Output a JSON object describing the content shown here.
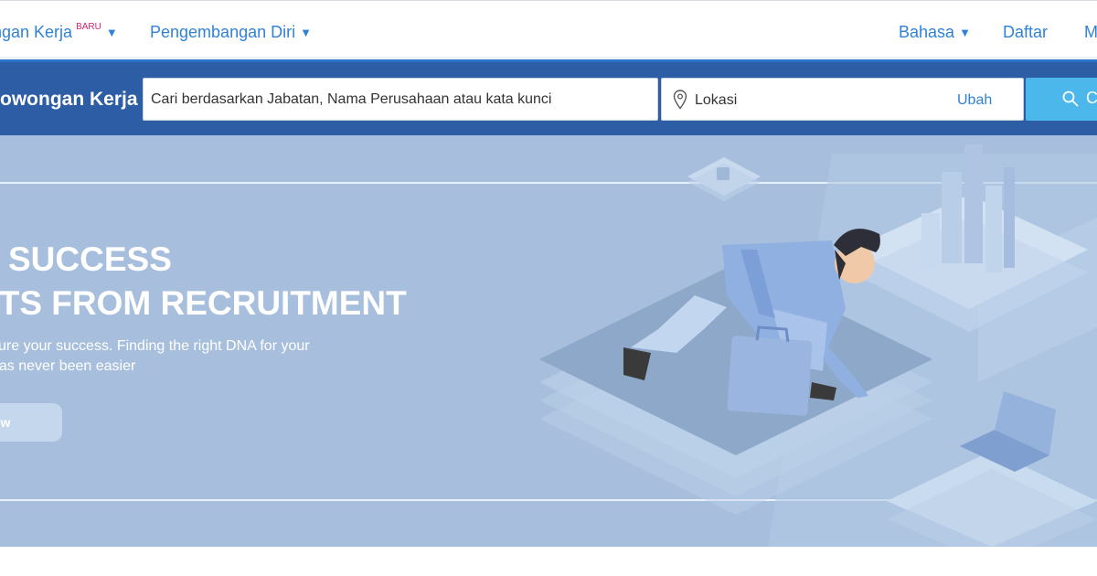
{
  "nav": {
    "jobs_label": "ngan Kerja",
    "jobs_badge": "BARU",
    "dev_label": "Pengembangan Diri",
    "lang_label": "Bahasa",
    "register_label": "Daftar",
    "more_label": "M"
  },
  "search": {
    "brand": "owongan Kerja",
    "keyword_placeholder": "Cari berdasarkan Jabatan, Nama Perusahaan atau kata kunci",
    "location_placeholder": "Lokasi",
    "change_label": "Ubah",
    "button_label": "C"
  },
  "hero": {
    "headline_line1": "R SUCCESS",
    "headline_line2": "RTS FROM RECRUITMENT",
    "sub_line1": "sure your success. Finding the right DNA for your",
    "sub_line2": "has never been easier",
    "cta_label": "ow"
  },
  "colors": {
    "nav_link": "#2f82d8",
    "badge": "#d21f6b",
    "search_bar_bg": "#2d5ea5",
    "search_button": "#4bb7ea",
    "hero_bg": "#a7bfdc"
  }
}
